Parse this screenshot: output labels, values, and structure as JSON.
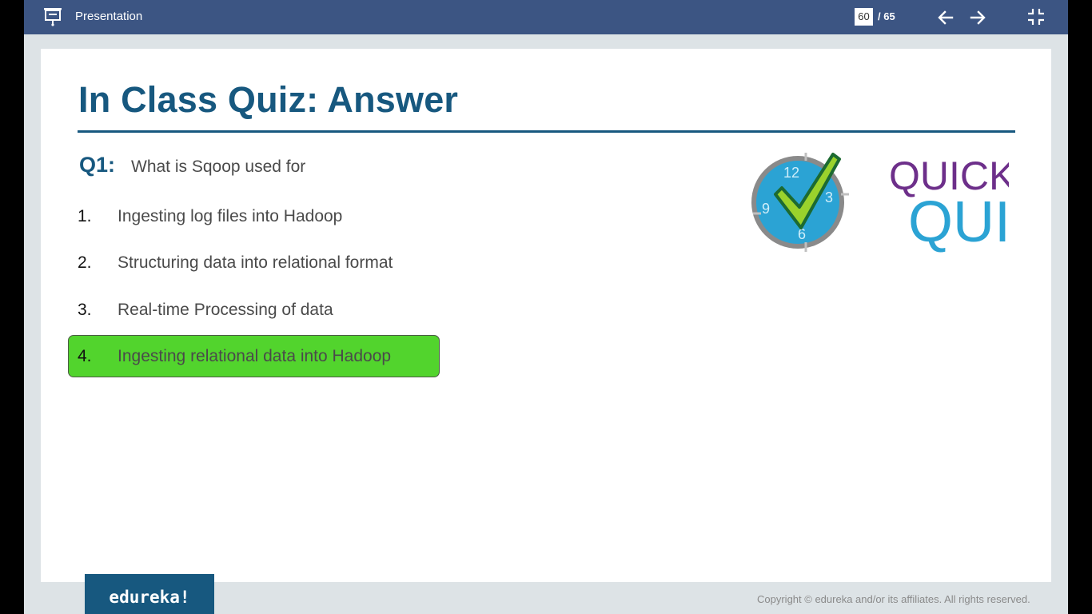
{
  "app": {
    "title": "Presentation",
    "current_page": "60",
    "total_pages": "/ 65"
  },
  "slide": {
    "title": "In Class Quiz: Answer",
    "question_label": "Q1:",
    "question_text": "What is Sqoop used for",
    "options": [
      {
        "number": "1.",
        "text": "Ingesting log files into Hadoop"
      },
      {
        "number": "2.",
        "text": "Structuring data into relational format"
      },
      {
        "number": "3.",
        "text": "Real-time Processing of data"
      },
      {
        "number": "4.",
        "text": "Ingesting relational data into Hadoop"
      }
    ],
    "correct_option": 4,
    "logo": {
      "line1": "QUICK",
      "line2": "QUIZ",
      "clock_numbers": [
        "12",
        "3",
        "6",
        "9"
      ]
    }
  },
  "footer": {
    "brand": "edureka!",
    "copyright": "Copyright © edureka and/or its affiliates. All rights reserved."
  },
  "icons": [
    "presentation-icon",
    "arrow-left-icon",
    "arrow-right-icon",
    "exit-fullscreen-icon"
  ],
  "colors": {
    "topbar": "#3c5583",
    "title": "#17587f",
    "answer_highlight": "#52d42d",
    "logo_purple": "#6d2f8a",
    "logo_blue": "#2ba3d4"
  }
}
